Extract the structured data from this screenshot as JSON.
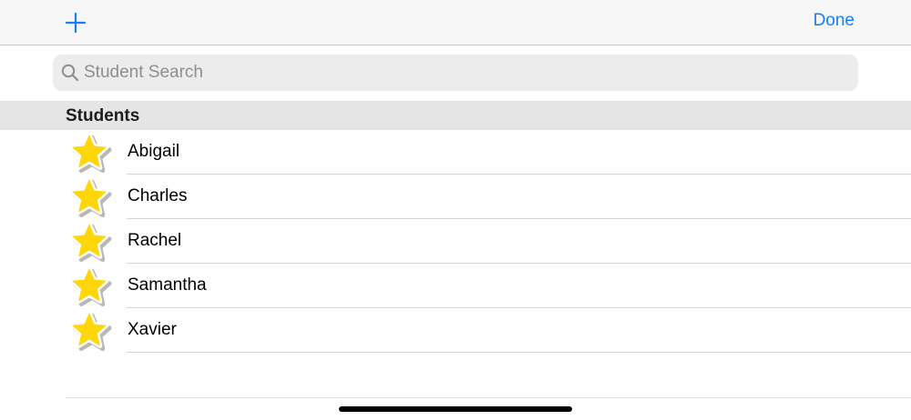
{
  "navbar": {
    "add_icon": "plus-icon",
    "done_label": "Done",
    "accent_color": "#147efb"
  },
  "search": {
    "icon": "search-icon",
    "placeholder": "Student Search",
    "value": ""
  },
  "section": {
    "title": "Students"
  },
  "students": [
    {
      "name": "Abigail",
      "icon": "star-icon"
    },
    {
      "name": "Charles",
      "icon": "star-icon"
    },
    {
      "name": "Rachel",
      "icon": "star-icon"
    },
    {
      "name": "Samantha",
      "icon": "star-icon"
    },
    {
      "name": "Xavier",
      "icon": "star-icon"
    }
  ],
  "colors": {
    "star_fill": "#ffd60a",
    "star_outline": "#ffffff",
    "navbar_bg": "#f7f7f7",
    "section_header_bg": "#e5e5e5"
  }
}
